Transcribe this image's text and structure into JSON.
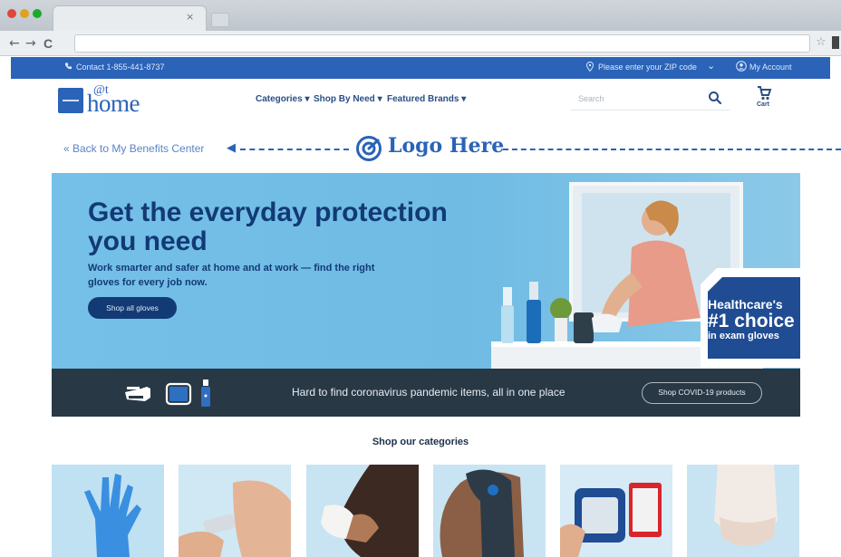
{
  "browser": {
    "tab_close": "×",
    "nav": {
      "back": "←",
      "forward": "→",
      "reload": "C"
    },
    "star": "☆"
  },
  "util_bar": {
    "contact_icon": "phone-icon",
    "contact": "Contact 1-855-441-8737",
    "zip_icon": "location-pin-icon",
    "zip": "Please enter your ZIP code",
    "zip_chevron": "⌄",
    "account_icon": "user-icon",
    "account": "My Account"
  },
  "header": {
    "logo_at": "@t",
    "logo_home": "home",
    "menu": {
      "categories": "Categories ▾",
      "shop_by_need": "Shop By Need ▾",
      "featured_brands": "Featured Brands ▾"
    },
    "search_placeholder": "Search",
    "cart_label": "Cart"
  },
  "back_link": "« Back to My Benefits Center",
  "back_arrow": "◀",
  "logo_here": "Logo Here",
  "hero": {
    "title": "Get the everyday protection you need",
    "subtitle": "Work smarter and safer at home and at work — find the right gloves for every job now.",
    "button": "Shop all gloves",
    "badge": {
      "line1": "Healthcare's",
      "line2": "#1 choice",
      "line3": "in exam gloves"
    }
  },
  "covid_strip": {
    "text": "Hard to find coronavirus pandemic items, all in one place",
    "button": "Shop COVID-19 products"
  },
  "categories": {
    "title": "Shop our categories"
  },
  "colors": {
    "brand_blue": "#2a63b8",
    "navy": "#123a75",
    "hero_bg": "#70bde6",
    "strip_bg": "#283845"
  }
}
